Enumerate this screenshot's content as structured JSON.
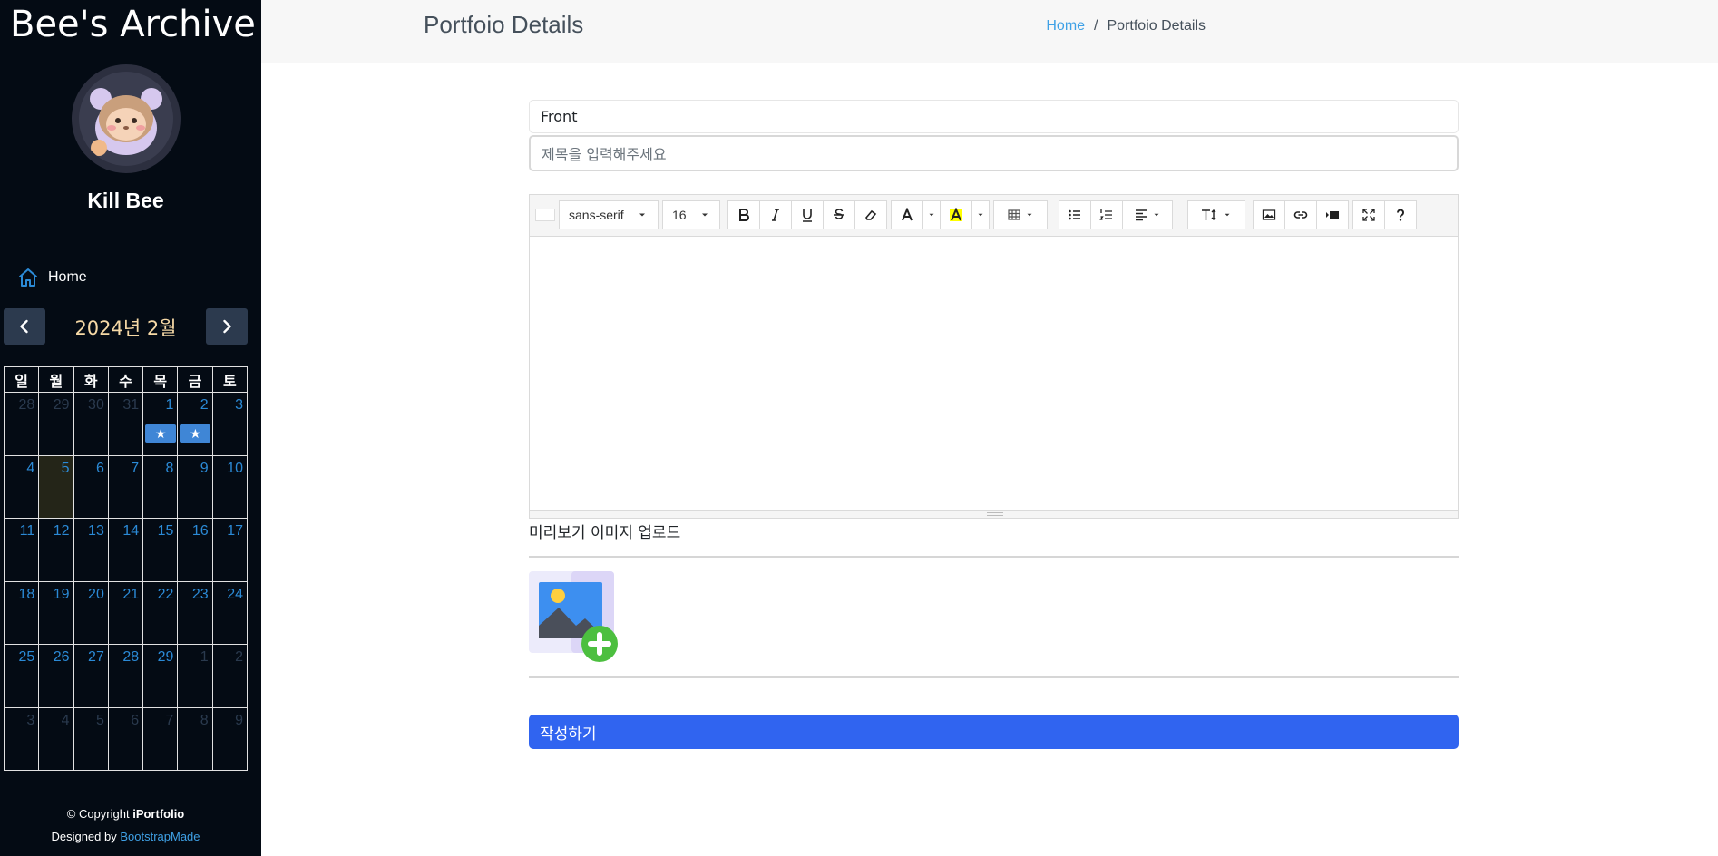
{
  "sidebar": {
    "site_title": "Bee's Archive",
    "user_name": "Kill Bee",
    "nav_home": "Home",
    "calendar": {
      "title": "2024년 2월",
      "weekdays": [
        "일",
        "월",
        "화",
        "수",
        "목",
        "금",
        "토"
      ],
      "weeks": [
        [
          "28",
          "29",
          "30",
          "31",
          "1",
          "2",
          "3"
        ],
        [
          "4",
          "5",
          "6",
          "7",
          "8",
          "9",
          "10"
        ],
        [
          "11",
          "12",
          "13",
          "14",
          "15",
          "16",
          "17"
        ],
        [
          "18",
          "19",
          "20",
          "21",
          "22",
          "23",
          "24"
        ],
        [
          "25",
          "26",
          "27",
          "28",
          "29",
          "1",
          "2"
        ],
        [
          "3",
          "4",
          "5",
          "6",
          "7",
          "8",
          "9"
        ]
      ],
      "event_marker": "★"
    },
    "footer": {
      "copyright_prefix": "© Copyright",
      "copyright_brand": "iPortfolio",
      "designed_by": "Designed by",
      "designer_link": "BootstrapMade"
    }
  },
  "breadcrumbs": {
    "page_title": "Portfoio Details",
    "home": "Home",
    "separator": "/",
    "current": "Portfoio Details"
  },
  "form": {
    "category_value": "Front",
    "title_placeholder": "제목을 입력해주세요",
    "toolbar": {
      "font_family": "sans-serif",
      "font_size": "16"
    },
    "preview_label": "미리보기 이미지 업로드",
    "submit_label": "작성하기"
  },
  "colors": {
    "sidebar_bg": "#040b14",
    "accent_blue": "#3064f0",
    "link_blue": "#3fa1e6",
    "calendar_title": "#f6d9a6"
  }
}
